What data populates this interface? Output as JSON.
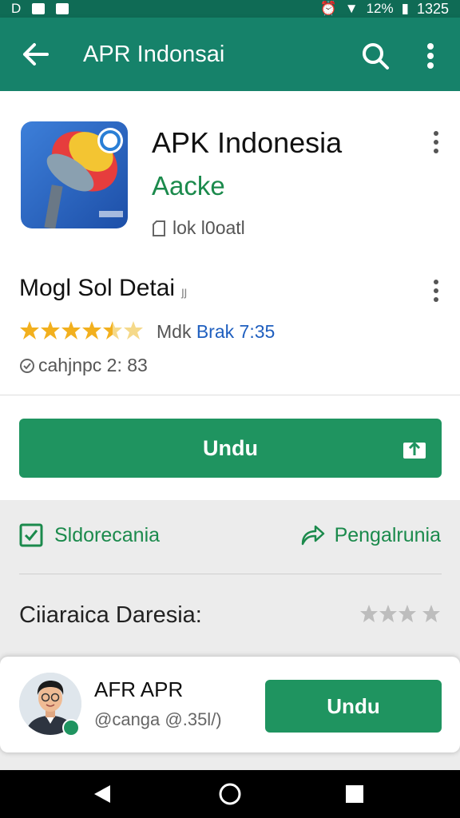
{
  "status_bar": {
    "left_text": "D",
    "battery": "12%",
    "time": "1325"
  },
  "app_bar": {
    "title": "APR Indonsai"
  },
  "app": {
    "name": "APK Indonesia",
    "developer": "Aacke",
    "size_text": "lok l0oatl",
    "subtitle": "Mogl Sol Detai",
    "subtitle_suffix": "ȷȷ",
    "rating_stars": 4.5,
    "meta_prefix": "Mdk",
    "meta_link": "Brak 7:35",
    "info_text": "cahjnpc 2: 83",
    "download_label": "Undu"
  },
  "actions": {
    "left_label": "Sldorecania",
    "right_label": "Pengalrunia"
  },
  "reviews": {
    "heading": "Ciiaraica Daresia:",
    "stars_gray": 3
  },
  "bottom_card": {
    "name": "AFR APR",
    "subtitle": "@canga @.35l/)",
    "button_label": "Undu"
  },
  "colors": {
    "primary": "#16826a",
    "status": "#0f6b55",
    "button": "#1f9460",
    "accent_text": "#1b8a4c",
    "link": "#1f5fbf"
  }
}
